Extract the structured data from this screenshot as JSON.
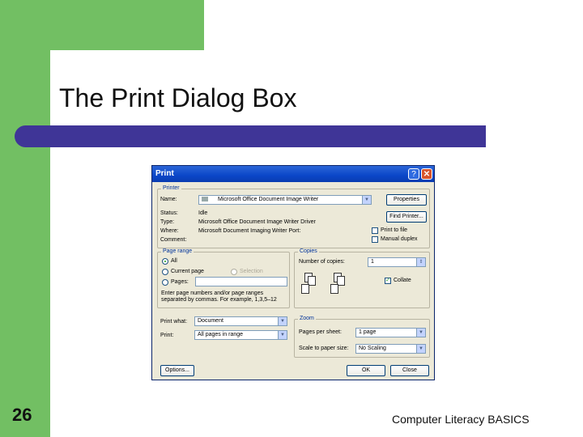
{
  "slide": {
    "title": "The Print Dialog Box",
    "number": "26",
    "footer": "Computer Literacy BASICS"
  },
  "dialog": {
    "title": "Print",
    "help_label": "?",
    "close_label": "✕",
    "printer": {
      "legend": "Printer",
      "name_label": "Name:",
      "name_value": "Microsoft Office Document Image Writer",
      "status_label": "Status:",
      "status_value": "Idle",
      "type_label": "Type:",
      "type_value": "Microsoft Office Document Image Writer Driver",
      "where_label": "Where:",
      "where_value": "Microsoft Document Imaging Writer Port:",
      "comment_label": "Comment:",
      "properties_label": "Properties",
      "find_printer_label": "Find Printer...",
      "print_to_file_label": "Print to file",
      "manual_duplex_label": "Manual duplex"
    },
    "page_range": {
      "legend": "Page range",
      "all_label": "All",
      "current_page_label": "Current page",
      "selection_label": "Selection",
      "pages_label": "Pages:",
      "help_text": "Enter page numbers and/or page ranges separated by commas.  For example, 1,3,5–12"
    },
    "copies": {
      "legend": "Copies",
      "number_label": "Number of copies:",
      "number_value": "1",
      "collate_label": "Collate",
      "collate_checked": true
    },
    "print_what_label": "Print what:",
    "print_what_value": "Document",
    "print_label": "Print:",
    "print_value": "All pages in range",
    "zoom": {
      "legend": "Zoom",
      "pages_per_sheet_label": "Pages per sheet:",
      "pages_per_sheet_value": "1 page",
      "scale_label": "Scale to paper size:",
      "scale_value": "No Scaling"
    },
    "options_label": "Options...",
    "ok_label": "OK",
    "cancel_label": "Close"
  }
}
